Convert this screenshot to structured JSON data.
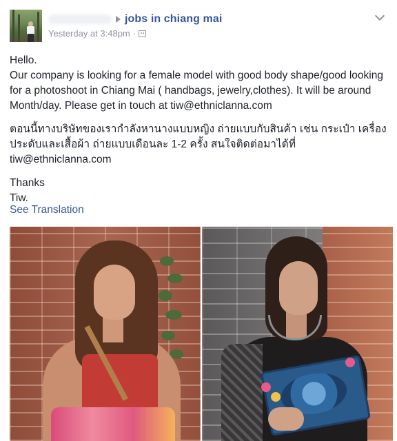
{
  "post": {
    "group_name": "jobs in chiang mai",
    "timestamp": "Yesterday at 3:48pm",
    "meta_separator": "·",
    "audience_icon": "group-audience-icon",
    "options_icon": "chevron-down-icon",
    "body": {
      "greeting": "Hello.",
      "english": "Our company is looking for a female model with good body shape/good looking for a photoshoot in Chiang Mai ( handbags, jewelry,clothes). It will be around Month/day. Please get in touch at tiw@ethniclanna.com",
      "thai_line1": "ตอนนี้ทางบริษัทของเรากำลังหานางแบบหญิง ถ่ายแบบกับสินค้า เช่น กระเป๋า เครื่องประดับและเสื้อผ้า ถ่ายแบบเดือนละ 1-2 ครั้ง สนใจติดต่อมาได้ที่",
      "thai_email": "tiw@ethniclanna.com",
      "thanks": "Thanks",
      "signature": "Tiw."
    },
    "see_translation": "See Translation"
  },
  "colors": {
    "link": "#365899",
    "text": "#1d2129",
    "meta": "#90949c"
  }
}
